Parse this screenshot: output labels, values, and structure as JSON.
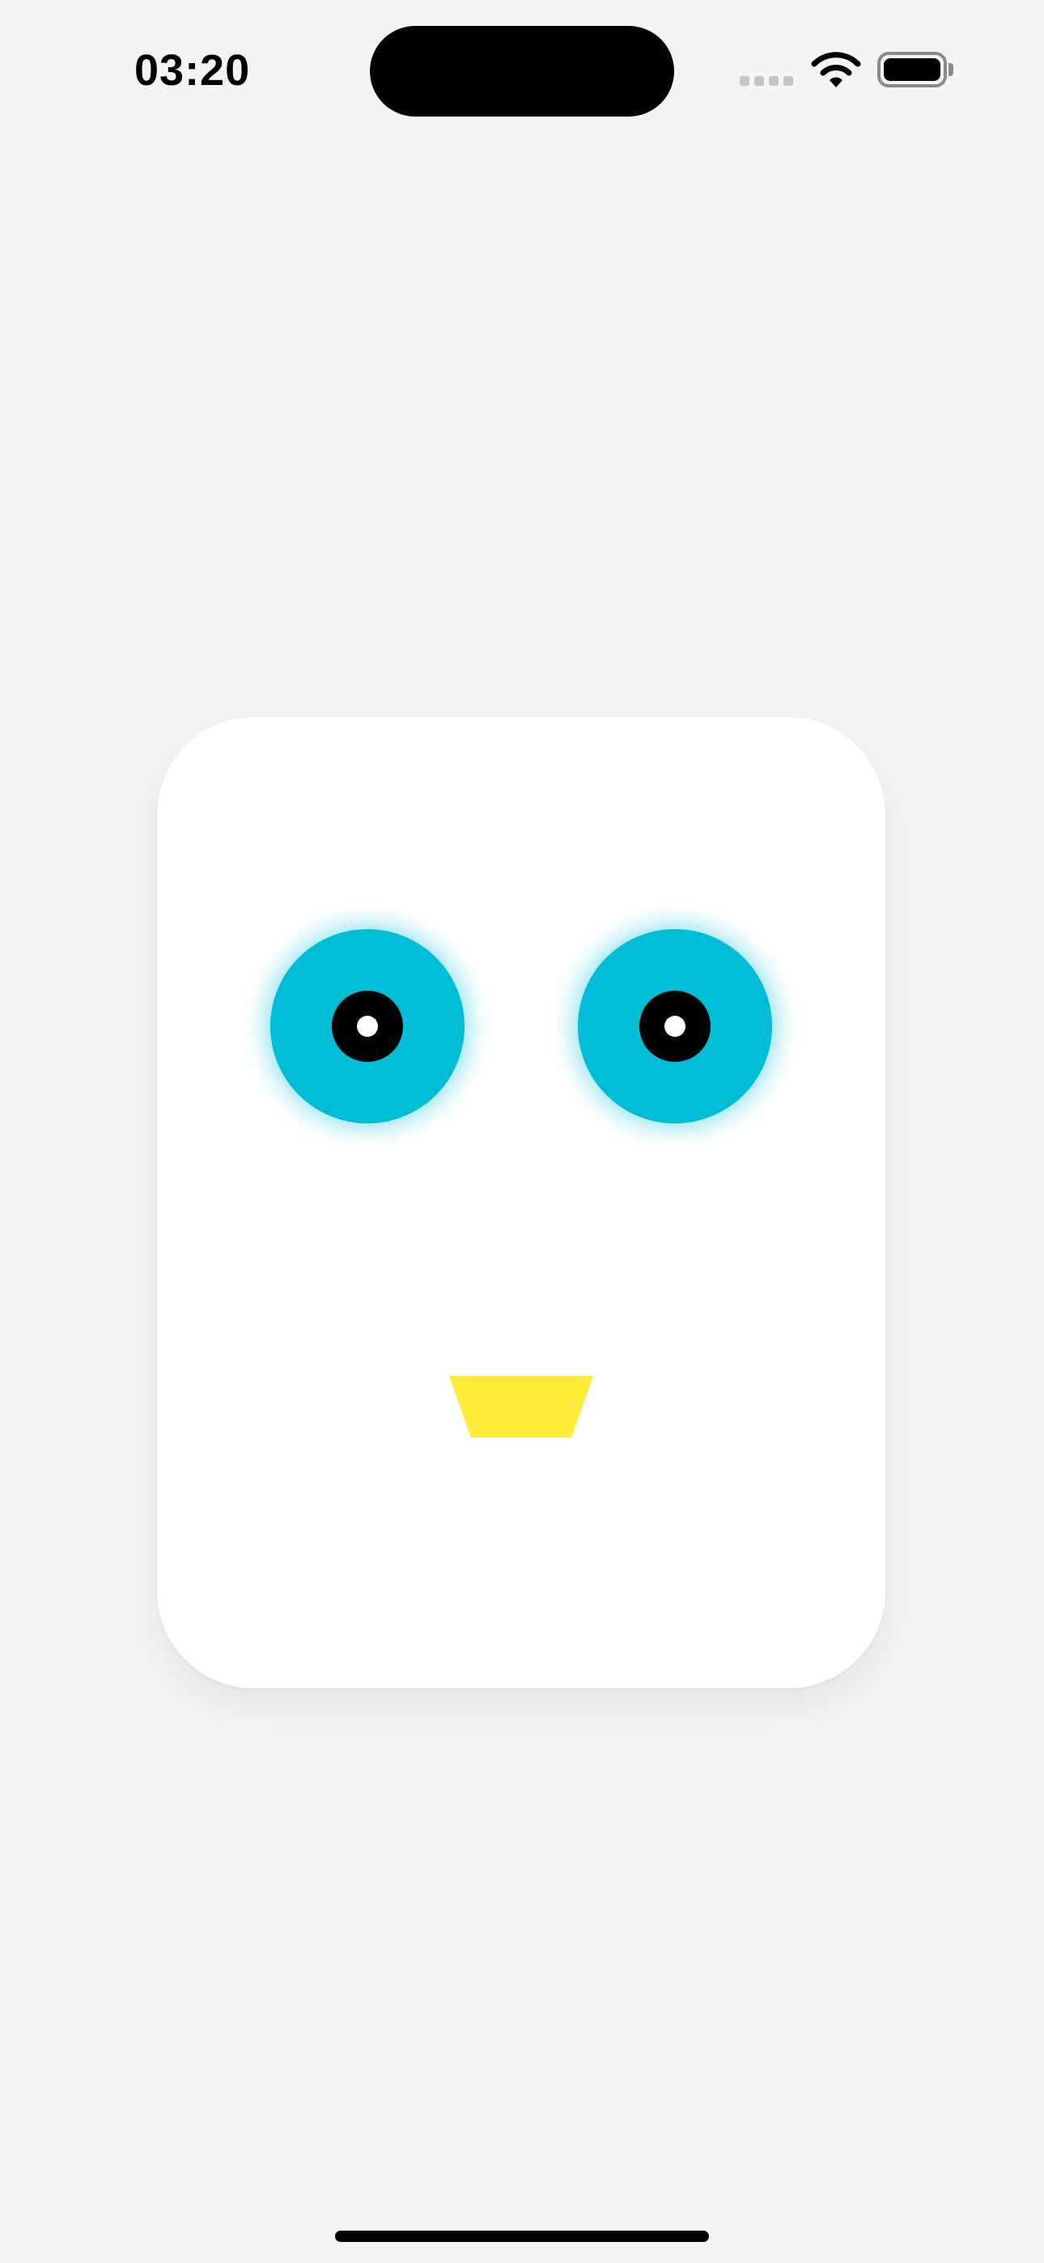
{
  "status_bar": {
    "time": "03:20"
  },
  "face": {
    "eye_color": "#00bcd4",
    "pupil_color": "#000000",
    "glint_color": "#ffffff",
    "mouth_color": "#ffeb3b",
    "card_color": "#ffffff"
  },
  "icons": {
    "signal": "cellular-signal-icon",
    "wifi": "wifi-icon",
    "battery": "battery-icon"
  }
}
